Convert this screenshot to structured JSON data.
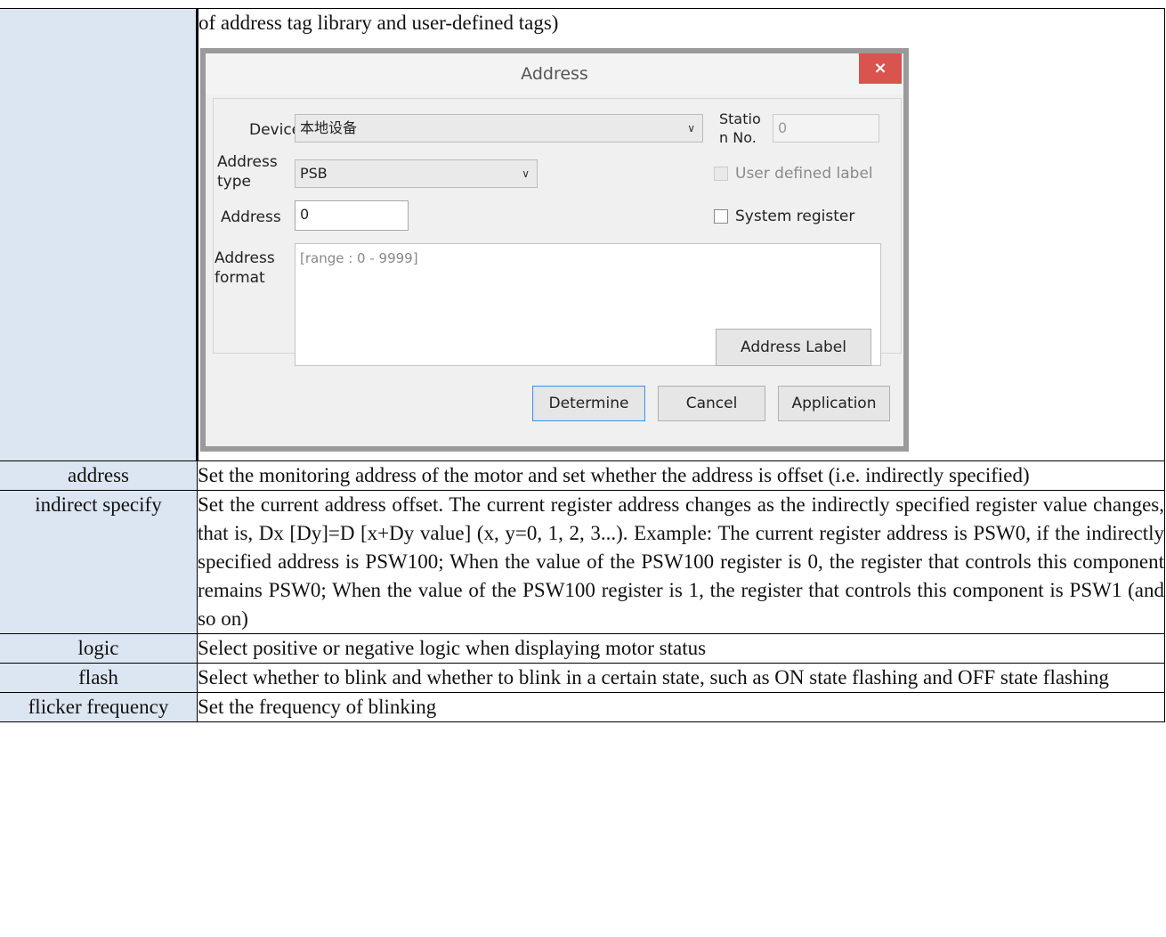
{
  "intro_text": "of address tag library and user-defined tags)",
  "dialog": {
    "title": "Address",
    "close_glyph": "×",
    "device_label": "Device",
    "device_value": "本地设备",
    "station_label": "Statio\nn No.",
    "station_label_line1": "Statio",
    "station_label_line2": "n No.",
    "station_value": "0",
    "address_type_label_line1": "Address",
    "address_type_label_line2": "type",
    "address_type_value": "PSB",
    "user_defined_label": "User defined label",
    "address_label": "Address",
    "address_value": "0",
    "system_register_label": "System register",
    "address_format_label_line1": "Address",
    "address_format_label_line2": "format",
    "address_format_value": "[range : 0 - 9999]",
    "address_label_button": "Address Label",
    "determine_button": "Determine",
    "cancel_button": "Cancel",
    "application_button": "Application",
    "chevron_icon": "chevron-down-icon"
  },
  "rows": [
    {
      "key": "address",
      "value": "Set the monitoring address of the motor and set whether the address is offset (i.e. indirectly specified)"
    },
    {
      "key": "indirect specify",
      "value": "Set the current address offset. The current register address changes as the indirectly specified register value changes, that is, Dx [Dy]=D [x+Dy value] (x, y=0, 1, 2, 3...). Example: The current register address is PSW0, if the indirectly specified address is PSW100; When the value of the PSW100 register is 0, the register that controls this component remains PSW0; When the value of the PSW100 register is 1, the register that controls this component is PSW1 (and so on)"
    },
    {
      "key": "logic",
      "value": "Select positive or negative logic when displaying motor status"
    },
    {
      "key": "flash",
      "value": "Select whether to blink and whether to blink in a certain state, such as ON state flashing and OFF state flashing"
    },
    {
      "key": "flicker frequency",
      "value": "Set the frequency of blinking"
    }
  ],
  "colors": {
    "key_cell_bg": "#dce6f2",
    "close_button": "#d9534f"
  }
}
